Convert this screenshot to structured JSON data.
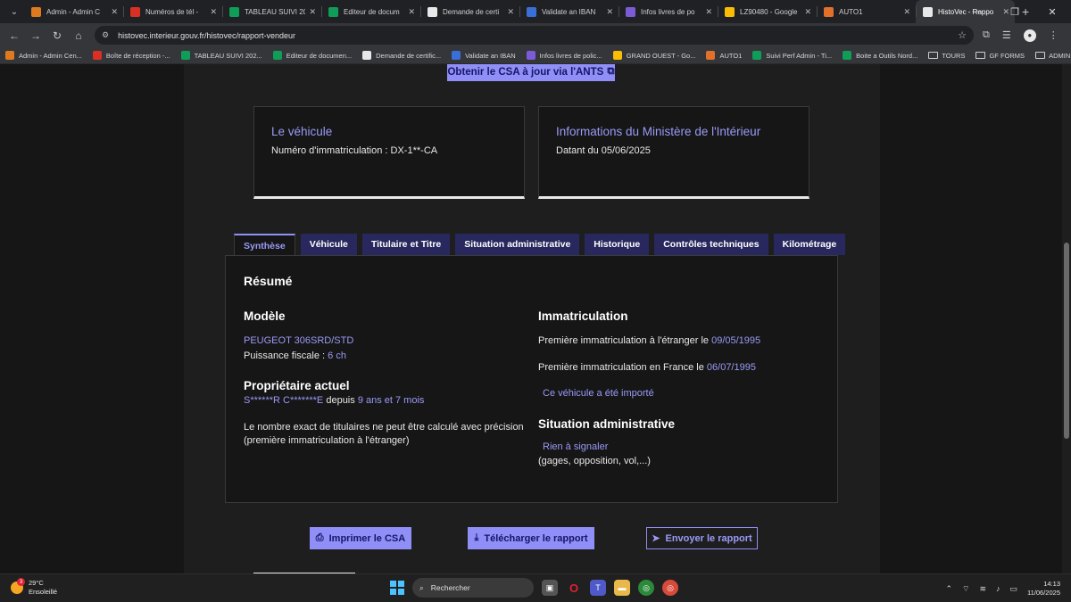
{
  "browser": {
    "tabs": [
      {
        "title": "Admin - Admin C",
        "color": "#e07a1f"
      },
      {
        "title": "Numéros de tél -",
        "color": "#d93025"
      },
      {
        "title": "TABLEAU SUIVI 20",
        "color": "#0f9d58"
      },
      {
        "title": "Editeur de docum",
        "color": "#0f9d58"
      },
      {
        "title": "Demande de certi",
        "color": "#e8e8e8"
      },
      {
        "title": "Validate an IBAN",
        "color": "#3b6fd8"
      },
      {
        "title": "Infos livres de po",
        "color": "#7b5cd6"
      },
      {
        "title": "LZ90480 - Google",
        "color": "#fbbc04"
      },
      {
        "title": "AUTO1",
        "color": "#e0702a"
      },
      {
        "title": "HistoVec - Rappo",
        "color": "#e8e8e8"
      }
    ],
    "url": "histovec.interieur.gouv.fr/histovec/rapport-vendeur",
    "bookmarks": [
      {
        "label": "Admin - Admin Cen...",
        "color": "#e07a1f"
      },
      {
        "label": "Boîte de réception -...",
        "color": "#d93025"
      },
      {
        "label": "TABLEAU SUIVI 202...",
        "color": "#0f9d58"
      },
      {
        "label": "Editeur de documen...",
        "color": "#0f9d58"
      },
      {
        "label": "Demande de certific...",
        "color": "#e8e8e8"
      },
      {
        "label": "Validate an IBAN",
        "color": "#3b6fd8"
      },
      {
        "label": "Infos livres de polic...",
        "color": "#7b5cd6"
      },
      {
        "label": "GRAND OUEST - Go...",
        "color": "#fbbc04"
      },
      {
        "label": "AUTO1",
        "color": "#e0702a"
      },
      {
        "label": "Suivi Perf Admin - Ti...",
        "color": "#0f9d58"
      },
      {
        "label": "Boite a Outils Nord...",
        "color": "#0f9d58"
      }
    ],
    "bookmark_folders": [
      "TOURS",
      "GF FORMS",
      "ADMIN"
    ]
  },
  "page": {
    "ants_button": "Obtenir le CSA à jour via l'ANTS",
    "vehicle_card": {
      "title": "Le véhicule",
      "text": "Numéro d'immatriculation : DX-1**-CA"
    },
    "ministry_card": {
      "title": "Informations du Ministère de l'Intérieur",
      "text": "Datant du 05/06/2025"
    },
    "tabs": [
      "Synthèse",
      "Véhicule",
      "Titulaire et Titre",
      "Situation administrative",
      "Historique",
      "Contrôles techniques",
      "Kilométrage"
    ],
    "summary": {
      "heading": "Résumé",
      "model_heading": "Modèle",
      "model_value": "PEUGEOT 306SRD/STD",
      "power_label": "Puissance fiscale : ",
      "power_value": "6 ch",
      "owner_heading": "Propriétaire actuel",
      "owner_name": "S******R C*******E",
      "owner_since_label": " depuis ",
      "owner_since_value": "9 ans et 7 mois",
      "owners_note_1": "Le nombre exact de titulaires ne peut être calculé avec précision",
      "owners_note_2": "(première immatriculation à l'étranger)",
      "registration_heading": "Immatriculation",
      "first_foreign_label": "Première immatriculation à l'étranger le ",
      "first_foreign_date": "09/05/1995",
      "first_france_label": "Première immatriculation en France le ",
      "first_france_date": "06/07/1995",
      "imported_text": "Ce véhicule a été importé",
      "admin_heading": "Situation administrative",
      "admin_status": "Rien à signaler",
      "admin_note": "(gages, opposition, vol,...)"
    },
    "actions": {
      "print": "Imprimer le CSA",
      "download": "Télécharger le rapport",
      "send": "Envoyer le rapport"
    }
  },
  "taskbar": {
    "temperature": "29°C",
    "weather": "Ensoleillé",
    "weather_badge": "3",
    "search_placeholder": "Rechercher",
    "time": "14:13",
    "date": "11/06/2025"
  }
}
